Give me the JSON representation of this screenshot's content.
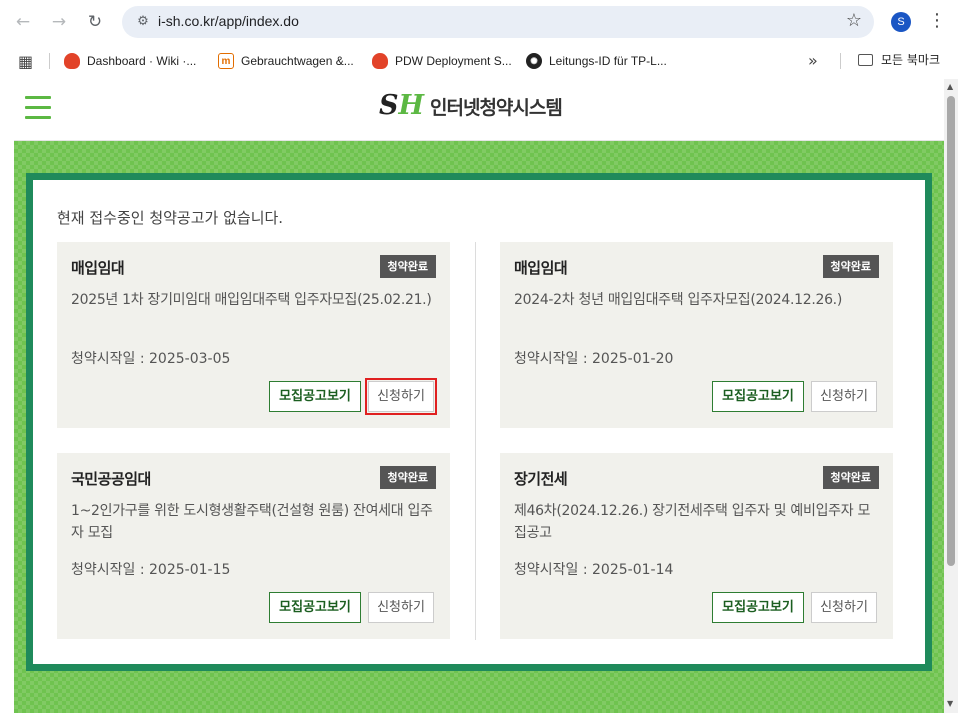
{
  "browser": {
    "url": "i-sh.co.kr/app/index.do",
    "profile_initial": "S",
    "icons": {
      "back": "←",
      "forward": "→",
      "reload": "↻",
      "site_info": "⚙",
      "star": "☆",
      "kebab": "⋮",
      "more": "»"
    },
    "bookmarks": [
      {
        "label": "Dashboard · Wiki ·...",
        "icon": "gitlab-icon"
      },
      {
        "label": "Gebrauchtwagen &...",
        "icon": "m-icon"
      },
      {
        "label": "PDW Deployment S...",
        "icon": "gitlab-icon"
      },
      {
        "label": "Leitungs-ID für TP-L...",
        "icon": "openai-icon"
      }
    ],
    "all_bookmarks_label": "모든 북마크"
  },
  "site": {
    "logo_s": "S",
    "logo_h": "H",
    "logo_text": "인터넷청약시스템"
  },
  "notice": "현재 접수중인 청약공고가 없습니다.",
  "cards": [
    {
      "title": "매입임대",
      "badge": "청약완료",
      "desc": "2025년 1차 장기미임대 매입임대주택 입주자모집(25.02.21.)",
      "date": "청약시작일 : 2025-03-05",
      "notice_button": "모집공고보기",
      "apply_button": "신청하기"
    },
    {
      "title": "매입임대",
      "badge": "청약완료",
      "desc": "2024-2차 청년 매입임대주택 입주자모집(2024.12.26.)",
      "date": "청약시작일 : 2025-01-20",
      "notice_button": "모집공고보기",
      "apply_button": "신청하기"
    },
    {
      "title": "국민공공임대",
      "badge": "청약완료",
      "desc": "1~2인가구를 위한 도시형생활주택(건설형 원룸) 잔여세대 입주자 모집",
      "date": "청약시작일 : 2025-01-15",
      "notice_button": "모집공고보기",
      "apply_button": "신청하기"
    },
    {
      "title": "장기전세",
      "badge": "청약완료",
      "desc": "제46차(2024.12.26.) 장기전세주택 입주자 및 예비입주자 모집공고",
      "date": "청약시작일 : 2025-01-14",
      "notice_button": "모집공고보기",
      "apply_button": "신청하기"
    }
  ]
}
